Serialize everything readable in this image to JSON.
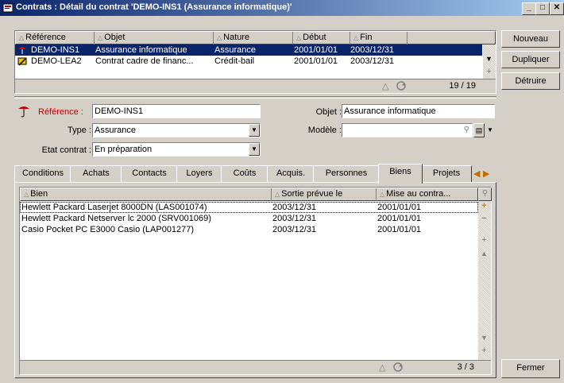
{
  "window": {
    "title": "Contrats : Détail du contrat 'DEMO-INS1 (Assurance informatique)'",
    "min_label": "_",
    "max_label": "□",
    "close_label": "✕"
  },
  "contracts_list": {
    "columns": [
      "Référence",
      "Objet",
      "Nature",
      "Début",
      "Fin"
    ],
    "rows": [
      {
        "ref": "DEMO-INS1",
        "objet": "Assurance informatique",
        "nature": "Assurance",
        "debut": "2001/01/01",
        "fin": "2003/12/31"
      },
      {
        "ref": "DEMO-LEA2",
        "objet": "Contrat cadre de financ...",
        "nature": "Crédit-bail",
        "debut": "2001/01/01",
        "fin": "2003/12/31"
      }
    ],
    "count": "19 / 19"
  },
  "side_buttons": {
    "new": "Nouveau",
    "duplicate": "Dupliquer",
    "delete": "Détruire",
    "close": "Fermer"
  },
  "detail": {
    "reference_label": "Référence :",
    "reference_value": "DEMO-INS1",
    "objet_label": "Objet :",
    "objet_value": "Assurance informatique",
    "type_label": "Type :",
    "type_value": "Assurance",
    "modele_label": "Modèle :",
    "modele_value": "",
    "etat_label": "Etat contrat :",
    "etat_value": "En préparation"
  },
  "tabs": [
    "Conditions",
    "Achats",
    "Contacts",
    "Loyers",
    "Coûts",
    "Acquis.",
    "Personnes",
    "Biens",
    "Projets"
  ],
  "assets_list": {
    "columns": [
      "Bien",
      "Sortie prévue le",
      "Mise au contra..."
    ],
    "rows": [
      {
        "bien": "Hewlett Packard Laserjet 8000DN (LAS001074)",
        "sortie": "2003/12/31",
        "mise": "2001/01/01"
      },
      {
        "bien": "Hewlett Packard Netserver lc 2000 (SRV001069)",
        "sortie": "2003/12/31",
        "mise": "2001/01/01"
      },
      {
        "bien": "Casio Pocket PC E3000 Casio (LAP001277)",
        "sortie": "2003/12/31",
        "mise": "2001/01/01"
      }
    ],
    "count": "3 / 3"
  },
  "colors": {
    "selection": "#0a246a",
    "title_start": "#0a246a",
    "title_end": "#a6caf0",
    "reference_label": "#c00000"
  }
}
